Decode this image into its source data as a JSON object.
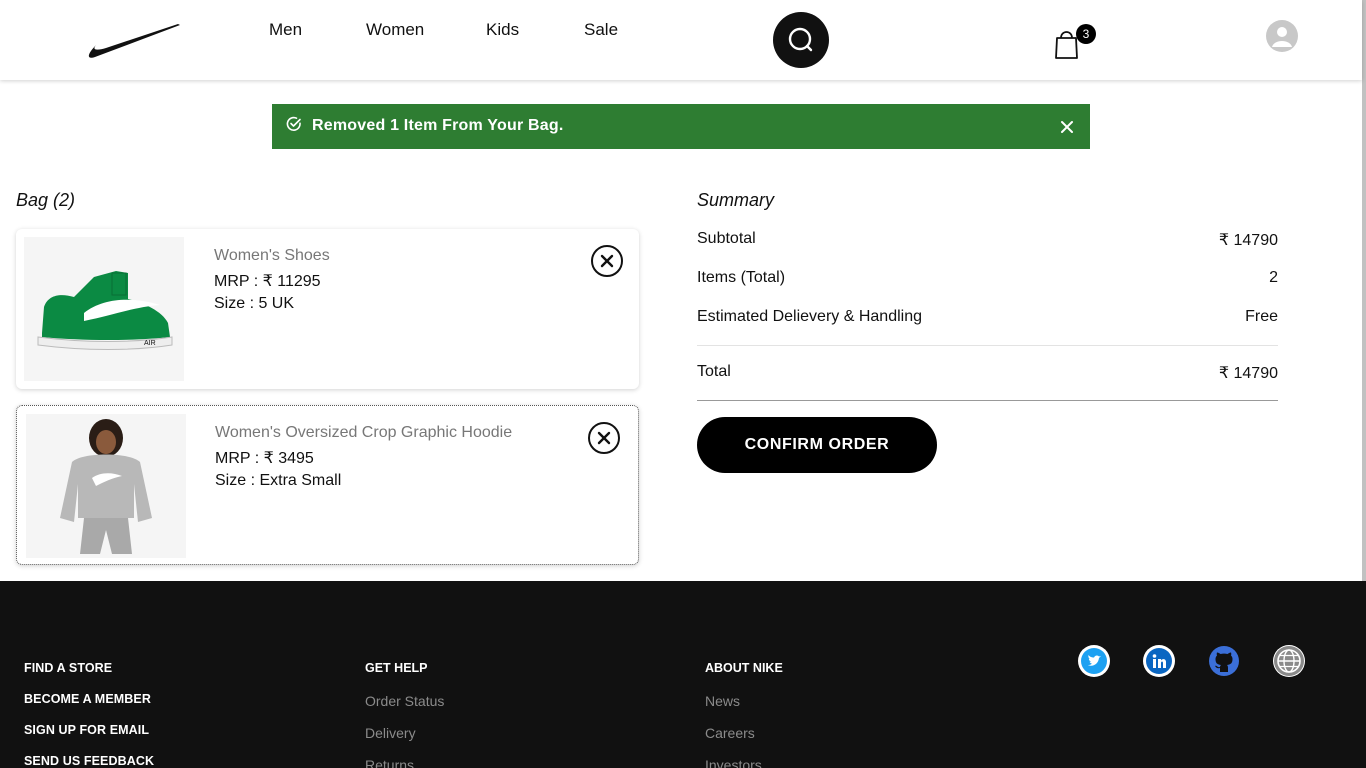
{
  "header": {
    "nav": [
      {
        "label": "Men"
      },
      {
        "label": "Women"
      },
      {
        "label": "Kids"
      },
      {
        "label": "Sale"
      }
    ],
    "cart_count": "3"
  },
  "toast": {
    "message": "Removed 1 Item From Your Bag.",
    "color": "#2e7d32"
  },
  "bag": {
    "title": "Bag (2)",
    "items": [
      {
        "name": "Women's Shoes",
        "mrp": "MRP : ₹ 11295",
        "size": "Size : 5 UK"
      },
      {
        "name": "Women's Oversized Crop Graphic Hoodie",
        "mrp": "MRP : ₹ 3495",
        "size": "Size : Extra Small"
      }
    ]
  },
  "summary": {
    "title": "Summary",
    "rows": [
      {
        "label": "Subtotal",
        "value": "₹ 14790"
      },
      {
        "label": "Items (Total)",
        "value": "2"
      },
      {
        "label": "Estimated Delievery & Handling",
        "value": "Free"
      },
      {
        "label": "Total",
        "value": "₹ 14790"
      }
    ],
    "confirm_label": "CONFIRM ORDER"
  },
  "footer": {
    "col1": [
      "FIND A STORE",
      "BECOME A MEMBER",
      "SIGN UP FOR EMAIL",
      "SEND US FEEDBACK"
    ],
    "col2": {
      "heading": "GET HELP",
      "links": [
        "Order Status",
        "Delivery",
        "Returns"
      ]
    },
    "col3": {
      "heading": "ABOUT NIKE",
      "links": [
        "News",
        "Careers",
        "Investors"
      ]
    },
    "social": [
      "twitter-icon",
      "linkedin-icon",
      "github-icon",
      "globe-icon"
    ]
  }
}
